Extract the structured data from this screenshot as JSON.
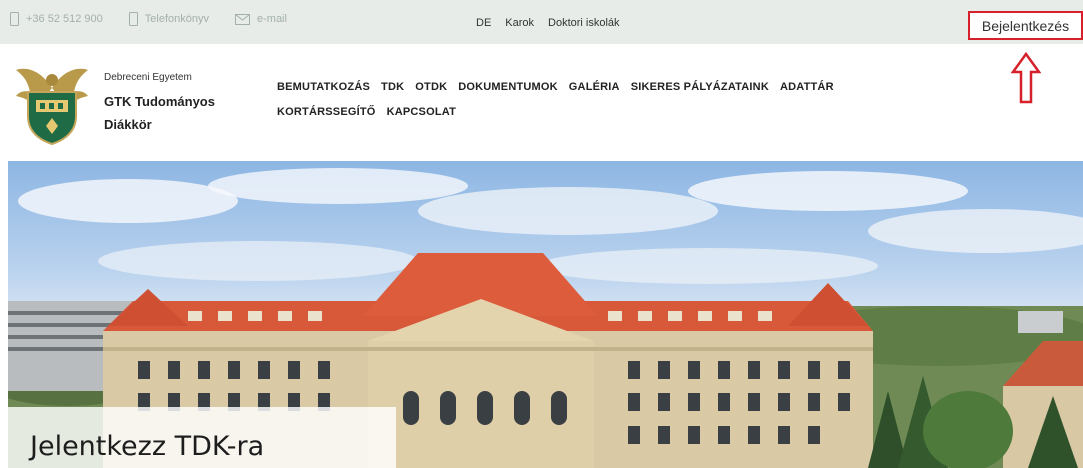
{
  "topbar": {
    "phone": "+36 52 512 900",
    "phonebook": "Telefonkönyv",
    "email": "e-mail",
    "links": [
      "DE",
      "Karok",
      "Doktori iskolák"
    ],
    "login_label": "Bejelentkezés"
  },
  "brand": {
    "line1": "Debreceni Egyetem",
    "line2": "GTK Tudományos",
    "line3": "Diákkör"
  },
  "nav": {
    "row1": [
      "BEMUTATKOZÁS",
      "TDK",
      "OTDK",
      "DOKUMENTUMOK",
      "GALÉRIA",
      "SIKERES PÁLYÁZATAINK",
      "ADATTÁR"
    ],
    "row2": [
      "KORTÁRSSEGÍTŐ",
      "KAPCSOLAT"
    ]
  },
  "hero": {
    "title": "Jelentkezz TDK-ra"
  },
  "colors": {
    "topbar_bg": "#e7ece9",
    "highlight_red": "#d6202a",
    "roof": "#d8583a",
    "facade": "#d9c9a4"
  },
  "icons": {
    "phone": "phone-icon",
    "phonebook": "phonebook-icon",
    "email": "envelope-icon",
    "annotation": "arrow-up-icon"
  }
}
